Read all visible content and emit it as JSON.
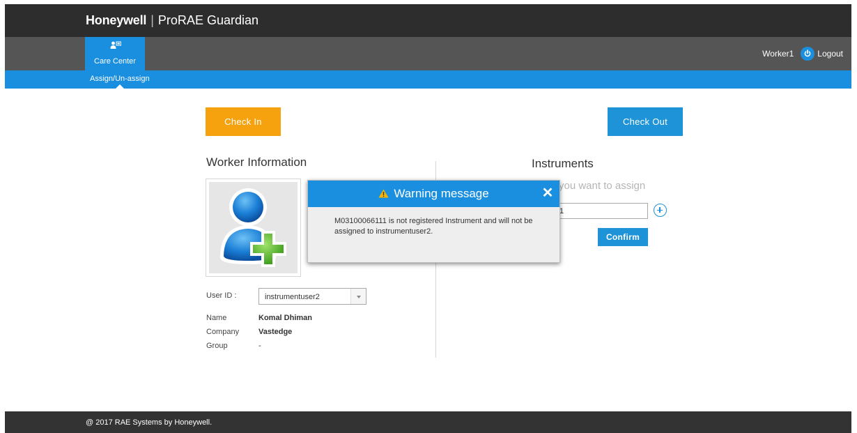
{
  "header": {
    "brand": "Honeywell",
    "separator": "|",
    "product": "ProRAE Guardian"
  },
  "nav": {
    "tab_label": "Care Center",
    "tab_icon": "care-center-icon",
    "user": "Worker1",
    "logout_label": "Logout"
  },
  "subnav": {
    "item": "Assign/Un-assign"
  },
  "actions": {
    "checkin_label": "Check In",
    "checkout_label": "Check Out"
  },
  "worker": {
    "title": "Worker Information",
    "userid_label": "User ID :",
    "userid_value": "instrumentuser2",
    "name_label": "Name",
    "name_value": "Komal Dhiman",
    "company_label": "Company",
    "company_value": "Vastedge",
    "group_label": "Group",
    "group_value": "-"
  },
  "instruments": {
    "title": "Instruments",
    "hint_visible": "you want to assign",
    "input_value_visible": "1",
    "confirm_label": "Confirm"
  },
  "modal": {
    "title": "Warning message",
    "message": "M03100066111 is not registered Instrument and will not be assigned to instrumentuser2."
  },
  "footer": {
    "copyright": "@ 2017 RAE Systems by Honeywell."
  },
  "colors": {
    "accent_blue": "#1b8fdf",
    "checkin_orange": "#f5a20e",
    "titlebar": "#2d2d2d",
    "navbar": "#555555",
    "footer": "#333333"
  }
}
